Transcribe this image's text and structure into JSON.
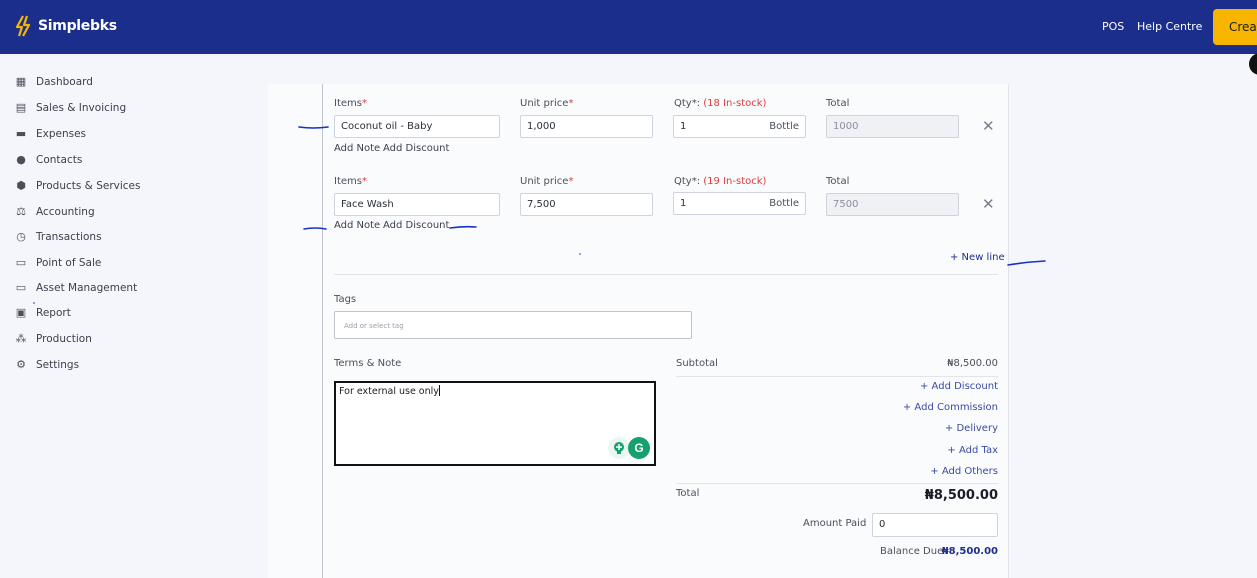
{
  "app": {
    "name": "Simplebks",
    "colors": {
      "header": "#1c2e8c",
      "accent": "#f7b500",
      "required": "#e03a3a",
      "link": "#3b4aa6"
    }
  },
  "header": {
    "links": [
      "POS",
      "Help Centre"
    ],
    "create_label": "Creat"
  },
  "sidebar": {
    "items": [
      {
        "label": "Dashboard",
        "icon": "dashboard-icon"
      },
      {
        "label": "Sales & Invoicing",
        "icon": "document-icon"
      },
      {
        "label": "Expenses",
        "icon": "wallet-icon"
      },
      {
        "label": "Contacts",
        "icon": "person-icon"
      },
      {
        "label": "Products & Services",
        "icon": "box-icon"
      },
      {
        "label": "Accounting",
        "icon": "scale-icon"
      },
      {
        "label": "Transactions",
        "icon": "clock-icon"
      },
      {
        "label": "Point of Sale",
        "icon": "card-icon"
      },
      {
        "label": "Asset Management",
        "icon": "card-icon"
      },
      {
        "label": "Report",
        "icon": "report-icon"
      },
      {
        "label": "Production",
        "icon": "people-icon"
      },
      {
        "label": "Settings",
        "icon": "gear-icon"
      }
    ]
  },
  "form": {
    "labels": {
      "items": "Items",
      "unit_price": "Unit price",
      "qty": "Qty",
      "total": "Total",
      "required_mark": "*"
    },
    "lines": [
      {
        "item": "Coconut oil - Baby",
        "unit_price": "1,000",
        "qty": "1",
        "unit": "Bottle",
        "stock": "(18 In-stock)",
        "total": "1000"
      },
      {
        "item": "Face Wash",
        "unit_price": "7,500",
        "qty": "1",
        "unit": "Bottle",
        "stock": "(19 In-stock)",
        "total": "7500"
      }
    ],
    "add_note": "Add Note",
    "add_discount": "Add Discount",
    "new_line": "+ New line",
    "tags_label": "Tags",
    "tags_placeholder": "Add or select tag",
    "terms_label": "Terms & Note",
    "terms_value": "For external use only"
  },
  "summary": {
    "subtotal_label": "Subtotal",
    "subtotal_value": "₦8,500.00",
    "actions": [
      "+ Add Discount",
      "+ Add Commission",
      "+ Delivery",
      "+ Add Tax",
      "+ Add Others"
    ],
    "total_label": "Total",
    "total_value": "₦8,500.00",
    "amount_paid_label": "Amount Paid",
    "amount_paid_value": "0",
    "balance_due_label": "Balance Due",
    "balance_due_value": "₦8,500.00"
  }
}
